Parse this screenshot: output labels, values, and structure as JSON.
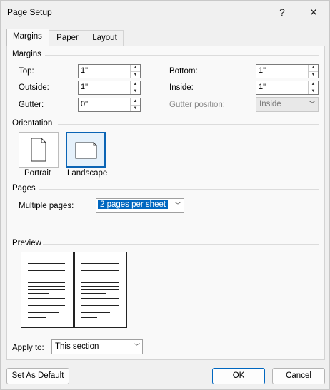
{
  "window": {
    "title": "Page Setup",
    "help_glyph": "?",
    "close_glyph": "✕"
  },
  "tabs": [
    {
      "label": "Margins"
    },
    {
      "label": "Paper"
    },
    {
      "label": "Layout"
    }
  ],
  "margins": {
    "group_label": "Margins",
    "top": {
      "label": "Top:",
      "value": "1\""
    },
    "outside": {
      "label": "Outside:",
      "value": "1\""
    },
    "gutter": {
      "label": "Gutter:",
      "value": "0\""
    },
    "bottom": {
      "label": "Bottom:",
      "value": "1\""
    },
    "inside": {
      "label": "Inside:",
      "value": "1\""
    },
    "gutter_position": {
      "label": "Gutter position:",
      "value": "Inside"
    }
  },
  "orientation": {
    "group_label": "Orientation",
    "portrait": "Portrait",
    "landscape": "Landscape",
    "selected": "landscape"
  },
  "pages": {
    "group_label": "Pages",
    "multiple_label": "Multiple pages:",
    "multiple_value": "2 pages per sheet"
  },
  "preview": {
    "group_label": "Preview"
  },
  "apply": {
    "label": "Apply to:",
    "value": "This section"
  },
  "buttons": {
    "default": "Set As Default",
    "ok": "OK",
    "cancel": "Cancel"
  }
}
